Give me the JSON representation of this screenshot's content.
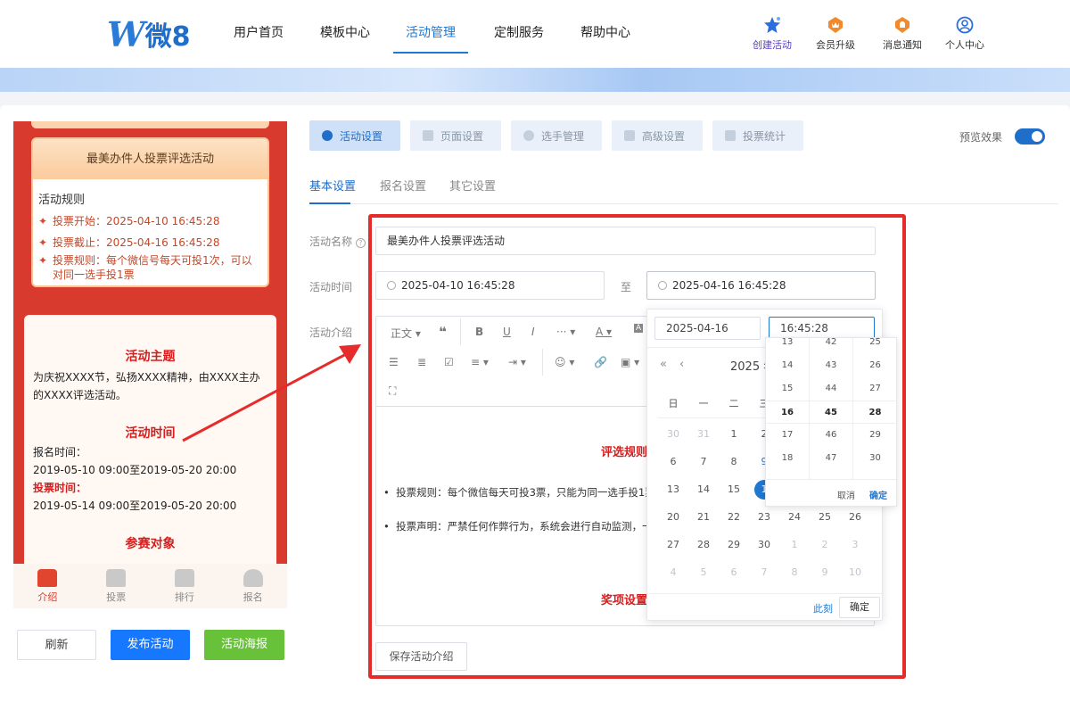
{
  "header": {
    "logo_prefix": "W",
    "logo_text": "微8",
    "nav": [
      "用户首页",
      "模板中心",
      "活动管理",
      "定制服务",
      "帮助中心"
    ],
    "nav_active": "活动管理",
    "actions": [
      {
        "label": "创建活动",
        "icon": "star-icon",
        "color": "#2b6cde"
      },
      {
        "label": "会员升级",
        "icon": "crown-badge-icon",
        "color": "#f08a2a"
      },
      {
        "label": "消息通知",
        "icon": "bell-badge-icon",
        "color": "#f08a2a"
      },
      {
        "label": "个人中心",
        "icon": "user-icon",
        "color": "#2b6cde"
      }
    ]
  },
  "preview": {
    "activity_title": "最美办件人投票评选活动",
    "rules_title": "活动规则",
    "rules": [
      "投票开始：2025-04-10 16:45:28",
      "投票截止：2025-04-16 16:45:28",
      "投票规则：每个微信号每天可投1次，可以对同一选手投1票"
    ],
    "theme_title": "活动主题",
    "theme_text": "为庆祝XXXX节，弘扬XXXX精神，由XXXX主办的XXXX评选活动。",
    "time_title": "活动时间",
    "signup_label": "报名时间：",
    "signup_time": "2019-05-10 09:00至2019-05-20 20:00",
    "vote_label": "投票时间：",
    "vote_time": "2019-05-14 09:00至2019-05-20 20:00",
    "target_title": "参赛对象",
    "tabs": [
      "介绍",
      "投票",
      "排行",
      "报名"
    ],
    "tab_icons": [
      "gift-icon",
      "home-icon",
      "crown-icon",
      "user-icon"
    ]
  },
  "left_buttons": {
    "refresh": "刷新",
    "publish": "发布活动",
    "poster": "活动海报"
  },
  "steps": [
    "活动设置",
    "页面设置",
    "选手管理",
    "高级设置",
    "投票统计"
  ],
  "preview_toggle_label": "预览效果",
  "subtabs": [
    "基本设置",
    "报名设置",
    "其它设置"
  ],
  "form": {
    "name_label": "活动名称",
    "name_value": "最美办件人投票评选活动",
    "time_label": "活动时间",
    "start_value": "2025-04-10 16:45:28",
    "to_label": "至",
    "end_value": "2025-04-16 16:45:28",
    "intro_label": "活动介绍"
  },
  "editor": {
    "toolbar_text": "正文",
    "content_heading1": "评选规则",
    "content_line1": "投票规则：每个微信每天可投3票，只能为同一选手投1票",
    "content_line2": "投票声明：严禁任何作弊行为，系统会进行自动监测，一",
    "content_heading2": "奖项设置",
    "save_button": "保存活动介绍"
  },
  "picker": {
    "date_value": "2025-04-16",
    "time_value": "16:45:28",
    "month_title": "2025 年",
    "weekdays": [
      "日",
      "一",
      "二",
      "三"
    ],
    "rows": [
      [
        "30",
        "31",
        "1",
        "2"
      ],
      [
        "6",
        "7",
        "8",
        "9"
      ],
      [
        "13",
        "14",
        "15",
        "1"
      ],
      [
        "20",
        "21",
        "22",
        "23",
        "24",
        "25",
        "26"
      ],
      [
        "27",
        "28",
        "29",
        "30",
        "1",
        "2",
        "3"
      ],
      [
        "4",
        "5",
        "6",
        "7",
        "8",
        "9",
        "10"
      ]
    ],
    "now_button": "此刻",
    "confirm_button": "确定",
    "time_hours": [
      "13",
      "14",
      "15",
      "16",
      "17",
      "18"
    ],
    "time_minutes": [
      "42",
      "43",
      "44",
      "45",
      "46",
      "47"
    ],
    "time_seconds": [
      "25",
      "26",
      "27",
      "28",
      "29",
      "30"
    ],
    "time_cancel": "取消",
    "time_confirm": "确定"
  },
  "colors": {
    "accent": "#1f6ec9",
    "highlight_frame": "#e62b2b",
    "publish_button": "#1677ff",
    "poster_button": "#67c23a"
  }
}
